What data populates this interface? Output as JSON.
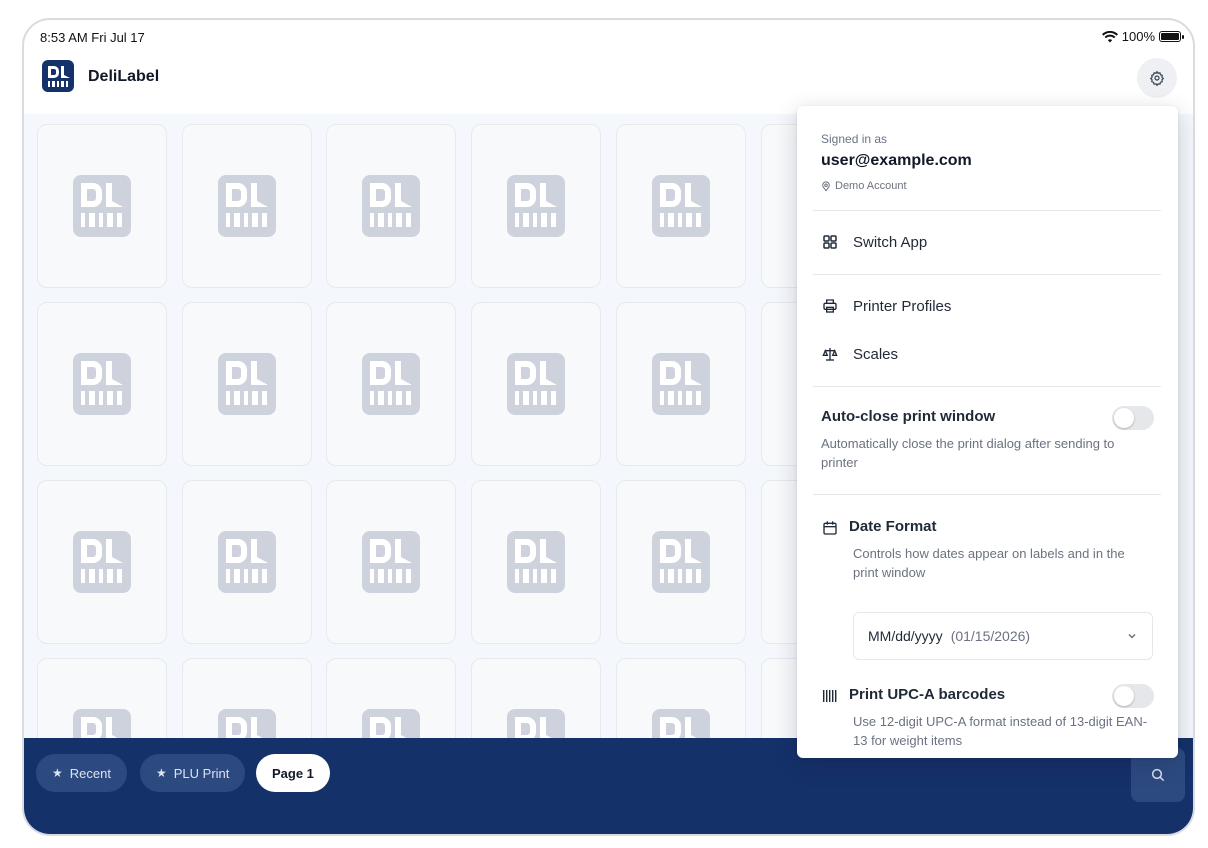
{
  "status_bar": {
    "time": "8:53 AM  Fri Jul 17",
    "battery": "100%"
  },
  "app": {
    "title": "DeliLabel"
  },
  "tiles": {
    "logo_text": "DL"
  },
  "bottom_bar": {
    "chips": [
      {
        "label": "Recent",
        "icon": "star-icon",
        "active": false
      },
      {
        "label": "PLU Print",
        "icon": "star-icon",
        "active": false
      },
      {
        "label": "Page 1",
        "active": true
      }
    ]
  },
  "menu": {
    "signed_in_label": "Signed in as",
    "email": "user@example.com",
    "account": "Demo Account",
    "items": {
      "switch_app": "Switch App",
      "printer_profiles": "Printer Profiles",
      "scales": "Scales"
    },
    "auto_close": {
      "title": "Auto-close print window",
      "description": "Automatically close the print dialog after sending to printer",
      "enabled": false
    },
    "date_format": {
      "title": "Date Format",
      "description": "Controls how dates appear on labels and in the print window",
      "selected_value": "MM/dd/yyyy",
      "selected_example": "(01/15/2026)"
    },
    "upc": {
      "title": "Print UPC-A barcodes",
      "description": "Use 12-digit UPC-A format instead of 13-digit EAN-13 for weight items",
      "enabled": false
    }
  },
  "colors": {
    "brand_navy": "#15316a",
    "chip_dark": "#2d4a80",
    "tile_logo": "#cdd2dc"
  }
}
